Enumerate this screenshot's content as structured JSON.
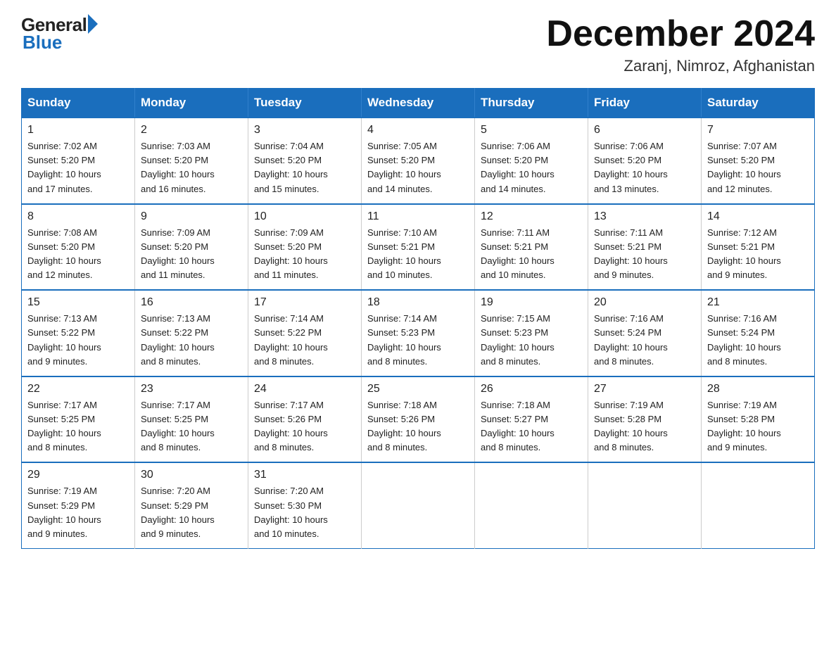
{
  "logo": {
    "general": "General",
    "blue": "Blue"
  },
  "header": {
    "month": "December 2024",
    "location": "Zaranj, Nimroz, Afghanistan"
  },
  "weekdays": [
    "Sunday",
    "Monday",
    "Tuesday",
    "Wednesday",
    "Thursday",
    "Friday",
    "Saturday"
  ],
  "weeks": [
    [
      {
        "day": "1",
        "info": "Sunrise: 7:02 AM\nSunset: 5:20 PM\nDaylight: 10 hours\nand 17 minutes."
      },
      {
        "day": "2",
        "info": "Sunrise: 7:03 AM\nSunset: 5:20 PM\nDaylight: 10 hours\nand 16 minutes."
      },
      {
        "day": "3",
        "info": "Sunrise: 7:04 AM\nSunset: 5:20 PM\nDaylight: 10 hours\nand 15 minutes."
      },
      {
        "day": "4",
        "info": "Sunrise: 7:05 AM\nSunset: 5:20 PM\nDaylight: 10 hours\nand 14 minutes."
      },
      {
        "day": "5",
        "info": "Sunrise: 7:06 AM\nSunset: 5:20 PM\nDaylight: 10 hours\nand 14 minutes."
      },
      {
        "day": "6",
        "info": "Sunrise: 7:06 AM\nSunset: 5:20 PM\nDaylight: 10 hours\nand 13 minutes."
      },
      {
        "day": "7",
        "info": "Sunrise: 7:07 AM\nSunset: 5:20 PM\nDaylight: 10 hours\nand 12 minutes."
      }
    ],
    [
      {
        "day": "8",
        "info": "Sunrise: 7:08 AM\nSunset: 5:20 PM\nDaylight: 10 hours\nand 12 minutes."
      },
      {
        "day": "9",
        "info": "Sunrise: 7:09 AM\nSunset: 5:20 PM\nDaylight: 10 hours\nand 11 minutes."
      },
      {
        "day": "10",
        "info": "Sunrise: 7:09 AM\nSunset: 5:20 PM\nDaylight: 10 hours\nand 11 minutes."
      },
      {
        "day": "11",
        "info": "Sunrise: 7:10 AM\nSunset: 5:21 PM\nDaylight: 10 hours\nand 10 minutes."
      },
      {
        "day": "12",
        "info": "Sunrise: 7:11 AM\nSunset: 5:21 PM\nDaylight: 10 hours\nand 10 minutes."
      },
      {
        "day": "13",
        "info": "Sunrise: 7:11 AM\nSunset: 5:21 PM\nDaylight: 10 hours\nand 9 minutes."
      },
      {
        "day": "14",
        "info": "Sunrise: 7:12 AM\nSunset: 5:21 PM\nDaylight: 10 hours\nand 9 minutes."
      }
    ],
    [
      {
        "day": "15",
        "info": "Sunrise: 7:13 AM\nSunset: 5:22 PM\nDaylight: 10 hours\nand 9 minutes."
      },
      {
        "day": "16",
        "info": "Sunrise: 7:13 AM\nSunset: 5:22 PM\nDaylight: 10 hours\nand 8 minutes."
      },
      {
        "day": "17",
        "info": "Sunrise: 7:14 AM\nSunset: 5:22 PM\nDaylight: 10 hours\nand 8 minutes."
      },
      {
        "day": "18",
        "info": "Sunrise: 7:14 AM\nSunset: 5:23 PM\nDaylight: 10 hours\nand 8 minutes."
      },
      {
        "day": "19",
        "info": "Sunrise: 7:15 AM\nSunset: 5:23 PM\nDaylight: 10 hours\nand 8 minutes."
      },
      {
        "day": "20",
        "info": "Sunrise: 7:16 AM\nSunset: 5:24 PM\nDaylight: 10 hours\nand 8 minutes."
      },
      {
        "day": "21",
        "info": "Sunrise: 7:16 AM\nSunset: 5:24 PM\nDaylight: 10 hours\nand 8 minutes."
      }
    ],
    [
      {
        "day": "22",
        "info": "Sunrise: 7:17 AM\nSunset: 5:25 PM\nDaylight: 10 hours\nand 8 minutes."
      },
      {
        "day": "23",
        "info": "Sunrise: 7:17 AM\nSunset: 5:25 PM\nDaylight: 10 hours\nand 8 minutes."
      },
      {
        "day": "24",
        "info": "Sunrise: 7:17 AM\nSunset: 5:26 PM\nDaylight: 10 hours\nand 8 minutes."
      },
      {
        "day": "25",
        "info": "Sunrise: 7:18 AM\nSunset: 5:26 PM\nDaylight: 10 hours\nand 8 minutes."
      },
      {
        "day": "26",
        "info": "Sunrise: 7:18 AM\nSunset: 5:27 PM\nDaylight: 10 hours\nand 8 minutes."
      },
      {
        "day": "27",
        "info": "Sunrise: 7:19 AM\nSunset: 5:28 PM\nDaylight: 10 hours\nand 8 minutes."
      },
      {
        "day": "28",
        "info": "Sunrise: 7:19 AM\nSunset: 5:28 PM\nDaylight: 10 hours\nand 9 minutes."
      }
    ],
    [
      {
        "day": "29",
        "info": "Sunrise: 7:19 AM\nSunset: 5:29 PM\nDaylight: 10 hours\nand 9 minutes."
      },
      {
        "day": "30",
        "info": "Sunrise: 7:20 AM\nSunset: 5:29 PM\nDaylight: 10 hours\nand 9 minutes."
      },
      {
        "day": "31",
        "info": "Sunrise: 7:20 AM\nSunset: 5:30 PM\nDaylight: 10 hours\nand 10 minutes."
      },
      {
        "day": "",
        "info": ""
      },
      {
        "day": "",
        "info": ""
      },
      {
        "day": "",
        "info": ""
      },
      {
        "day": "",
        "info": ""
      }
    ]
  ]
}
